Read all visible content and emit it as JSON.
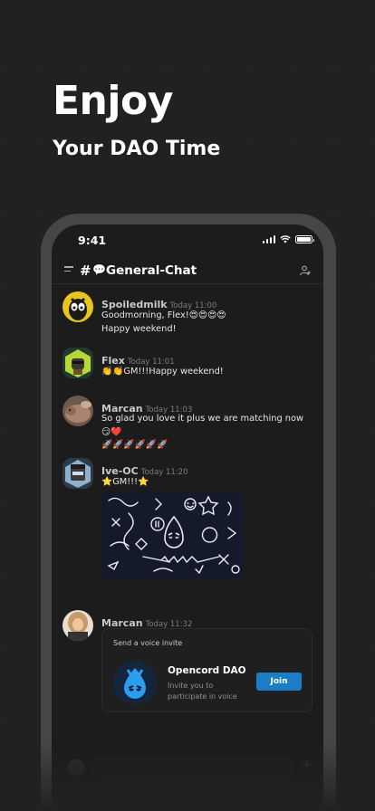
{
  "hero": {
    "title": "Enjoy",
    "subtitle": "Your DAO Time"
  },
  "status_bar": {
    "time": "9:41"
  },
  "channel": {
    "hash": "#",
    "emoji": "💬",
    "name": "General-Chat",
    "icons": [
      "menu-icon",
      "add-user-icon"
    ]
  },
  "messages": [
    {
      "author": "Spoiledmilk",
      "timestamp": "Today 11:00",
      "lines": [
        "Goodmorning, Flex!😍😍😍😍",
        "Happy weekend!"
      ],
      "avatar_color": "#e6c21e"
    },
    {
      "author": "Flex",
      "timestamp": "Today 11:01",
      "lines": [
        "👏👏GM!!!Happy weekend!"
      ],
      "avatar_color": "#b6d334"
    },
    {
      "author": "Marcan",
      "timestamp": "Today 11:03",
      "lines": [
        "So glad you love it plus we are matching now 😏❤️",
        "🚀🚀🚀🚀🚀🚀"
      ],
      "avatar_color": "#a3806c"
    },
    {
      "author": "Ive-OC",
      "timestamp": "Today 11:20",
      "lines": [
        "⭐GM!!!⭐"
      ],
      "avatar_color": "#8aa7c4",
      "attachment": "doodle-sticker-image"
    },
    {
      "author": "Marcan",
      "timestamp": "Today 11:32",
      "avatar_color": "#caa37d",
      "invite": {
        "caption": "Send a voice invite",
        "server_name": "Opencord DAO",
        "description": "Invite you to participate in voice",
        "join_label": "Join"
      }
    }
  ],
  "composer": {
    "placeholder": "",
    "icons": [
      "emoji-icon",
      "plus-icon"
    ]
  },
  "colors": {
    "background": "#212121",
    "phone_frame": "#464646",
    "screen": "#1c1c1d",
    "accent": "#1c7dc7"
  }
}
